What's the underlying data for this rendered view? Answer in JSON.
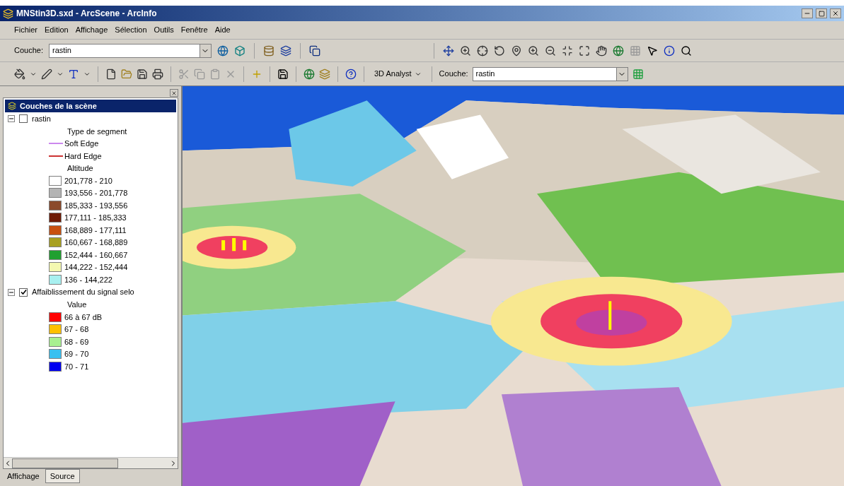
{
  "window": {
    "title": "MNStin3D.sxd - ArcScene - ArcInfo"
  },
  "menu": [
    "Fichier",
    "Edition",
    "Affichage",
    "Sélection",
    "Outils",
    "Fenêtre",
    "Aide"
  ],
  "toolbar_layer": {
    "label": "Couche:",
    "value": "rastin"
  },
  "toolbar_analyst": {
    "menu": "3D Analyst",
    "label": "Couche:",
    "value": "rastin"
  },
  "toc": {
    "title": "Couches de la scène",
    "layers": [
      {
        "name": "rastin",
        "checked": false,
        "expanded": true,
        "groups": [
          {
            "heading": "Type de segment",
            "entries": [
              {
                "kind": "line",
                "label": "Soft Edge",
                "color": "#cc88ee"
              },
              {
                "kind": "line",
                "label": "Hard Edge",
                "color": "#cc3333"
              }
            ]
          },
          {
            "heading": "Altitude",
            "entries": [
              {
                "kind": "swatch",
                "label": "201,778 - 210",
                "color": "#ffffff"
              },
              {
                "kind": "swatch",
                "label": "193,556 - 201,778",
                "color": "#b4b4b4"
              },
              {
                "kind": "swatch",
                "label": "185,333 - 193,556",
                "color": "#8b4a2b"
              },
              {
                "kind": "swatch",
                "label": "177,111 - 185,333",
                "color": "#6e1a05"
              },
              {
                "kind": "swatch",
                "label": "168,889 - 177,111",
                "color": "#c85010"
              },
              {
                "kind": "swatch",
                "label": "160,667 - 168,889",
                "color": "#a8a020"
              },
              {
                "kind": "swatch",
                "label": "152,444 - 160,667",
                "color": "#20a030"
              },
              {
                "kind": "swatch",
                "label": "144,222 - 152,444",
                "color": "#f4f8b0"
              },
              {
                "kind": "swatch",
                "label": "136 - 144,222",
                "color": "#a8f0f0"
              }
            ]
          }
        ]
      },
      {
        "name": "Affaiblissement du signal selo",
        "checked": true,
        "expanded": true,
        "groups": [
          {
            "heading": "Value",
            "entries": [
              {
                "kind": "swatch",
                "label": "66 à 67 dB",
                "color": "#ff0000"
              },
              {
                "kind": "swatch",
                "label": "67 - 68",
                "color": "#ffc000"
              },
              {
                "kind": "swatch",
                "label": "68 - 69",
                "color": "#a8f090"
              },
              {
                "kind": "swatch",
                "label": "69 - 70",
                "color": "#38c0f0"
              },
              {
                "kind": "swatch",
                "label": "70 - 71",
                "color": "#0000f0"
              }
            ]
          }
        ]
      }
    ]
  },
  "tabs": [
    {
      "label": "Affichage",
      "selected": true
    },
    {
      "label": "Source",
      "selected": false
    }
  ]
}
